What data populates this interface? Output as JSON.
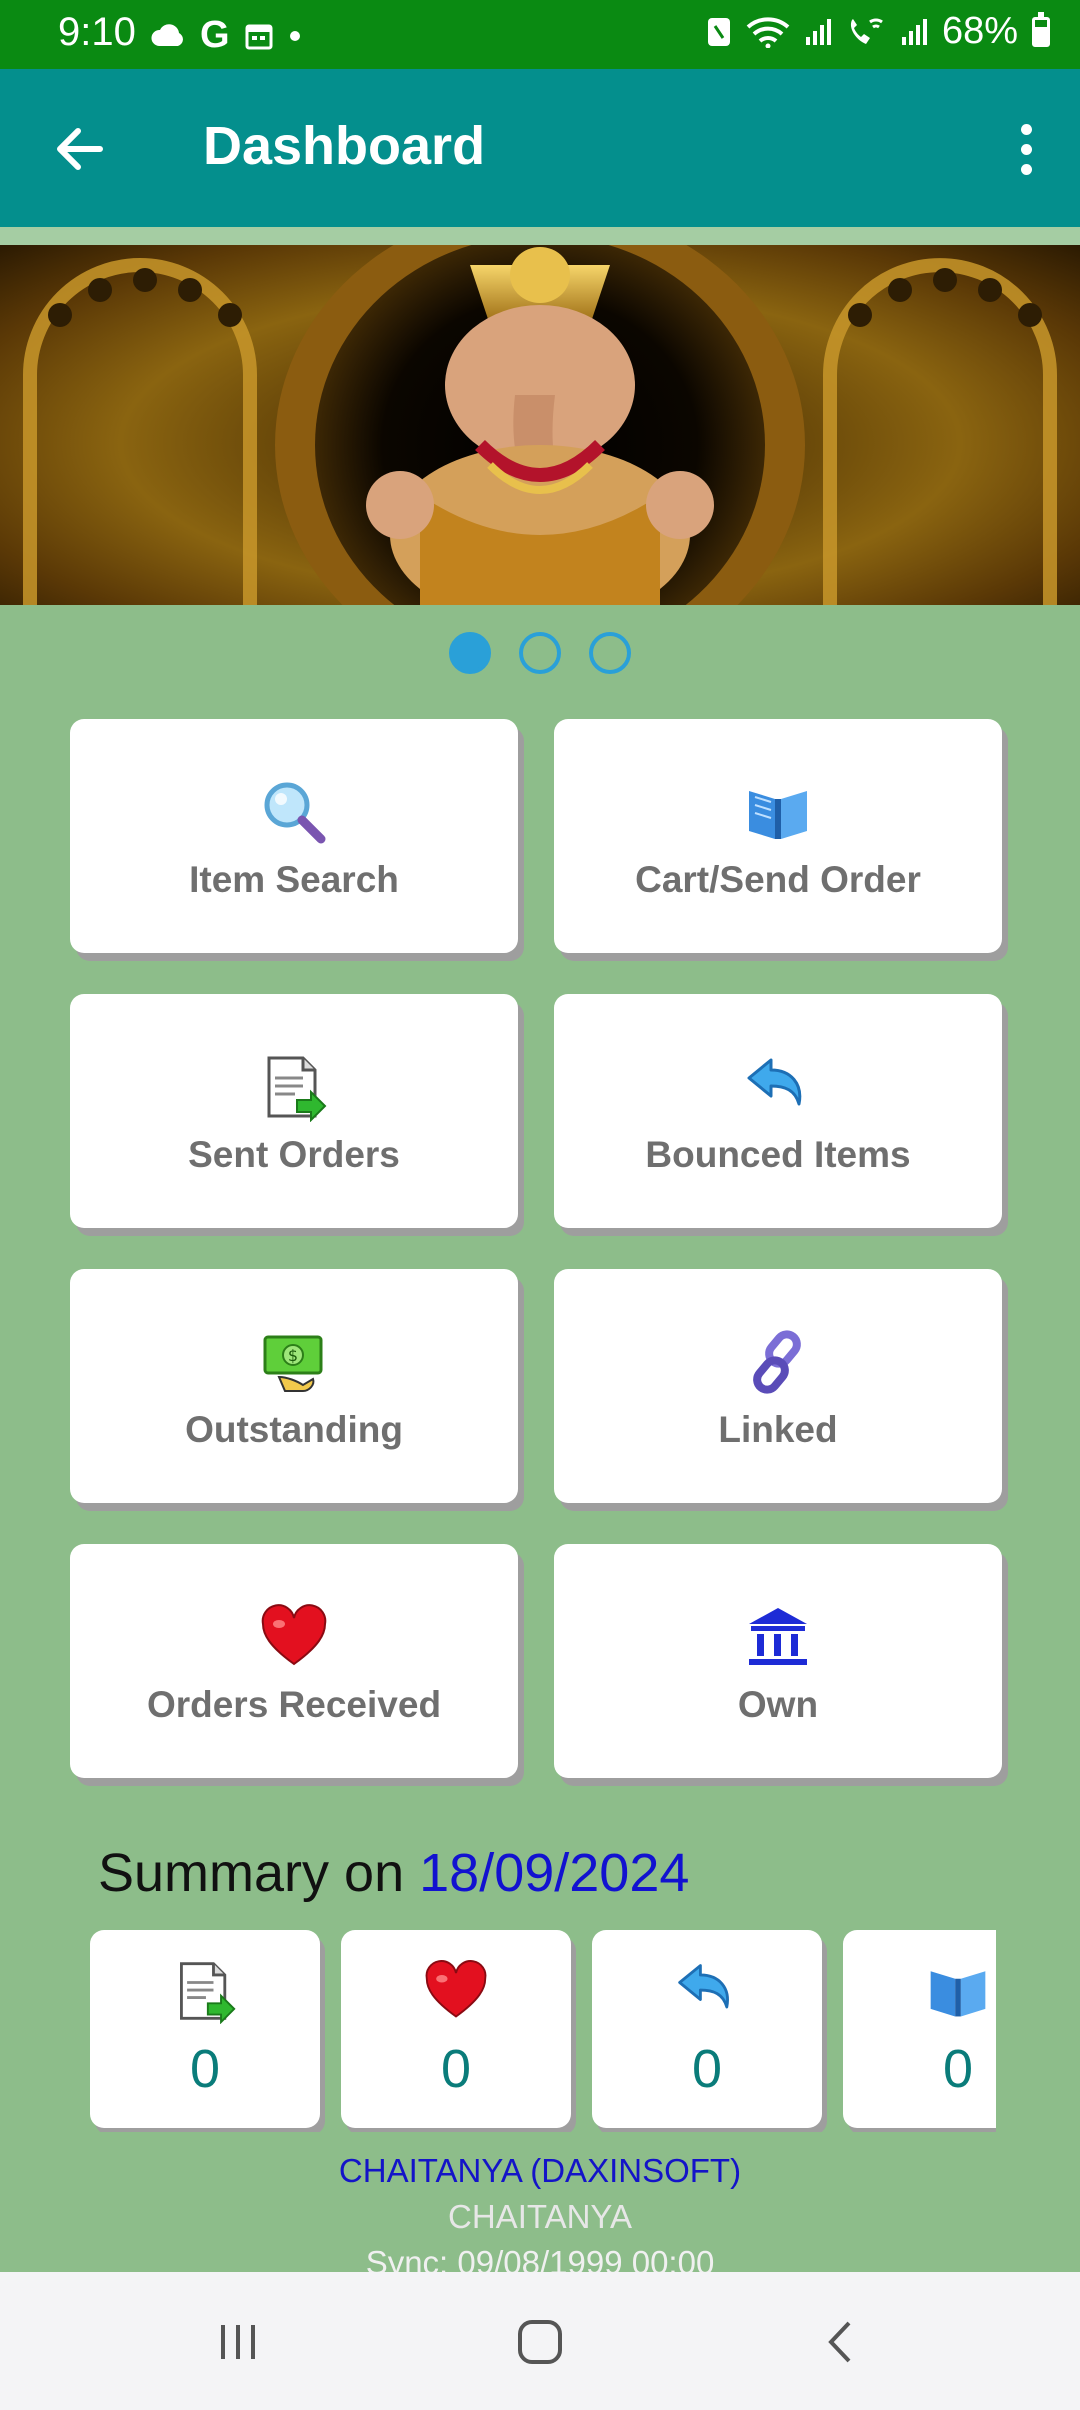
{
  "status_bar": {
    "time": "9:10",
    "left_icons": [
      "cloud-icon",
      "google-icon",
      "calendar-icon",
      "dot-icon"
    ],
    "battery_percent": "68%",
    "right_icons": [
      "nfc-icon",
      "wifi-icon",
      "signal-icon",
      "wifi-calling-icon",
      "signal-icon",
      "battery-icon"
    ]
  },
  "app_bar": {
    "title": "Dashboard",
    "back_icon": "arrow-left-icon",
    "menu_icon": "more-vertical-icon",
    "color": "#048f8d"
  },
  "banner": {
    "pages": 3,
    "active_page": 1
  },
  "tiles": [
    {
      "label": "Item Search",
      "icon": "magnifier-icon"
    },
    {
      "label": "Cart/Send Order",
      "icon": "open-book-icon"
    },
    {
      "label": "Sent Orders",
      "icon": "document-send-icon"
    },
    {
      "label": "Bounced Items",
      "icon": "undo-arrow-icon"
    },
    {
      "label": "Outstanding",
      "icon": "money-icon"
    },
    {
      "label": "Linked",
      "icon": "chain-link-icon"
    },
    {
      "label": "Orders Received",
      "icon": "heart-icon"
    },
    {
      "label": "Own",
      "icon": "bank-icon"
    }
  ],
  "summary": {
    "label": "Summary on",
    "date": "18/09/2024",
    "cards": [
      {
        "icon": "document-send-icon",
        "value": "0"
      },
      {
        "icon": "heart-icon",
        "value": "0"
      },
      {
        "icon": "undo-arrow-icon",
        "value": "0"
      },
      {
        "icon": "open-book-icon",
        "value": "0"
      }
    ]
  },
  "footer": {
    "account": "CHAITANYA (DAXINSOFT)",
    "name": "CHAITANYA",
    "sync": "Sync: 09/08/1999 00:00"
  },
  "nav_bar": {
    "buttons": [
      "recent-apps-icon",
      "home-icon",
      "back-icon"
    ]
  },
  "colors": {
    "background": "#8dbd8a",
    "status_bar": "#0a8a12",
    "accent_blue": "#2aa0d8",
    "date_blue": "#1212d0",
    "value_teal": "#0a7c7a"
  }
}
